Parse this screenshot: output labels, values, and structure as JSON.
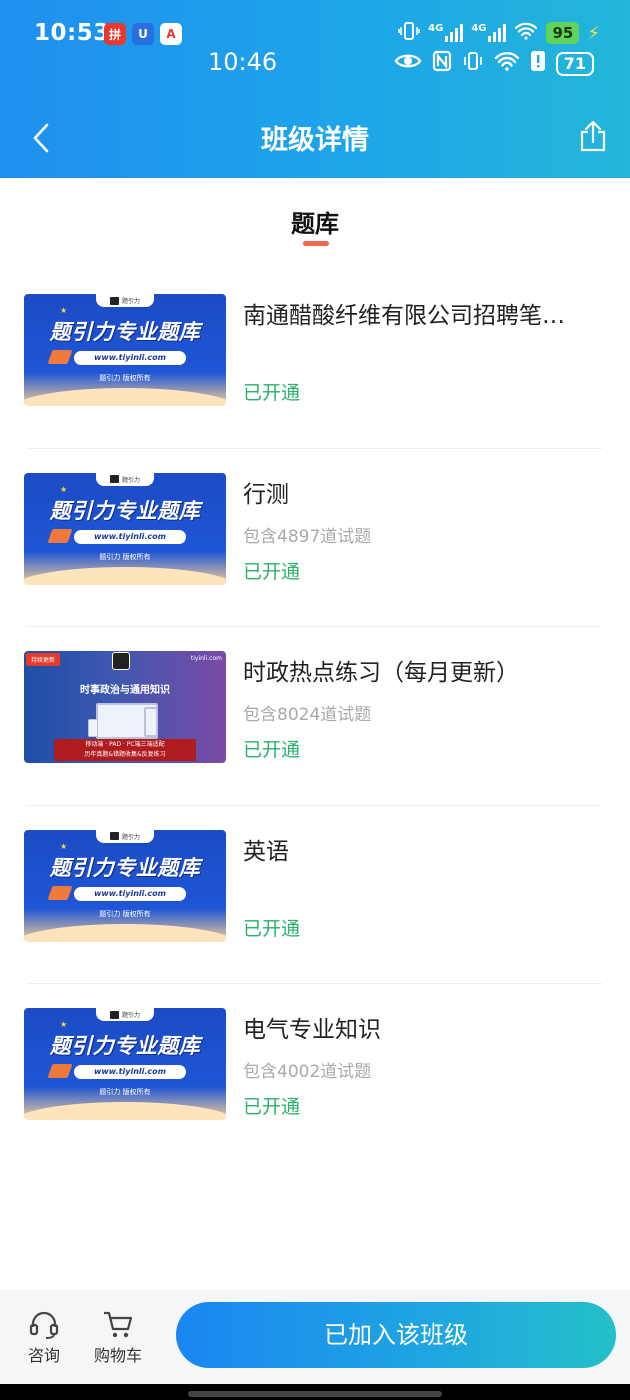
{
  "status_bar": {
    "time_primary": "10:53",
    "time_secondary": "10:46",
    "app_icon_labels": [
      "拼",
      "U",
      "A"
    ],
    "network_1": "4G",
    "network_2": "4G",
    "battery_primary": "95",
    "battery_secondary": "71"
  },
  "header": {
    "title": "班级详情",
    "back_icon": "chevron-left-icon",
    "share_icon": "share-icon"
  },
  "tab": {
    "label": "题库",
    "indicator_color": "#ee6a4f"
  },
  "thumb_text": {
    "headline": "题引力专业题库",
    "url": "www.tiyinli.com",
    "copyright": "题引力 版权所有",
    "logo_text": "题引力",
    "purple_tag": "持续更新",
    "purple_site": "tiyinli.com",
    "purple_headline": "时事政治与通用知识",
    "purple_banner_1": "移动端 · PAD · PC端三端适配",
    "purple_banner_2": "历年真题&错题收集&反复练习"
  },
  "items": [
    {
      "title": "南通醋酸纤维有限公司招聘笔…",
      "count": "",
      "status": "已开通"
    },
    {
      "title": "行测",
      "count": "包含4897道试题",
      "status": "已开通"
    },
    {
      "title": "时政热点练习（每月更新）",
      "count": "包含8024道试题",
      "status": "已开通"
    },
    {
      "title": "英语",
      "count": "",
      "status": "已开通"
    },
    {
      "title": "电气专业知识",
      "count": "包含4002道试题",
      "status": "已开通"
    }
  ],
  "bottom_bar": {
    "consult_label": "咨询",
    "cart_label": "购物车",
    "joined_label": "已加入该班级"
  },
  "colors": {
    "status_green": "#2bb26a",
    "accent_blue": "#1a86f2"
  }
}
